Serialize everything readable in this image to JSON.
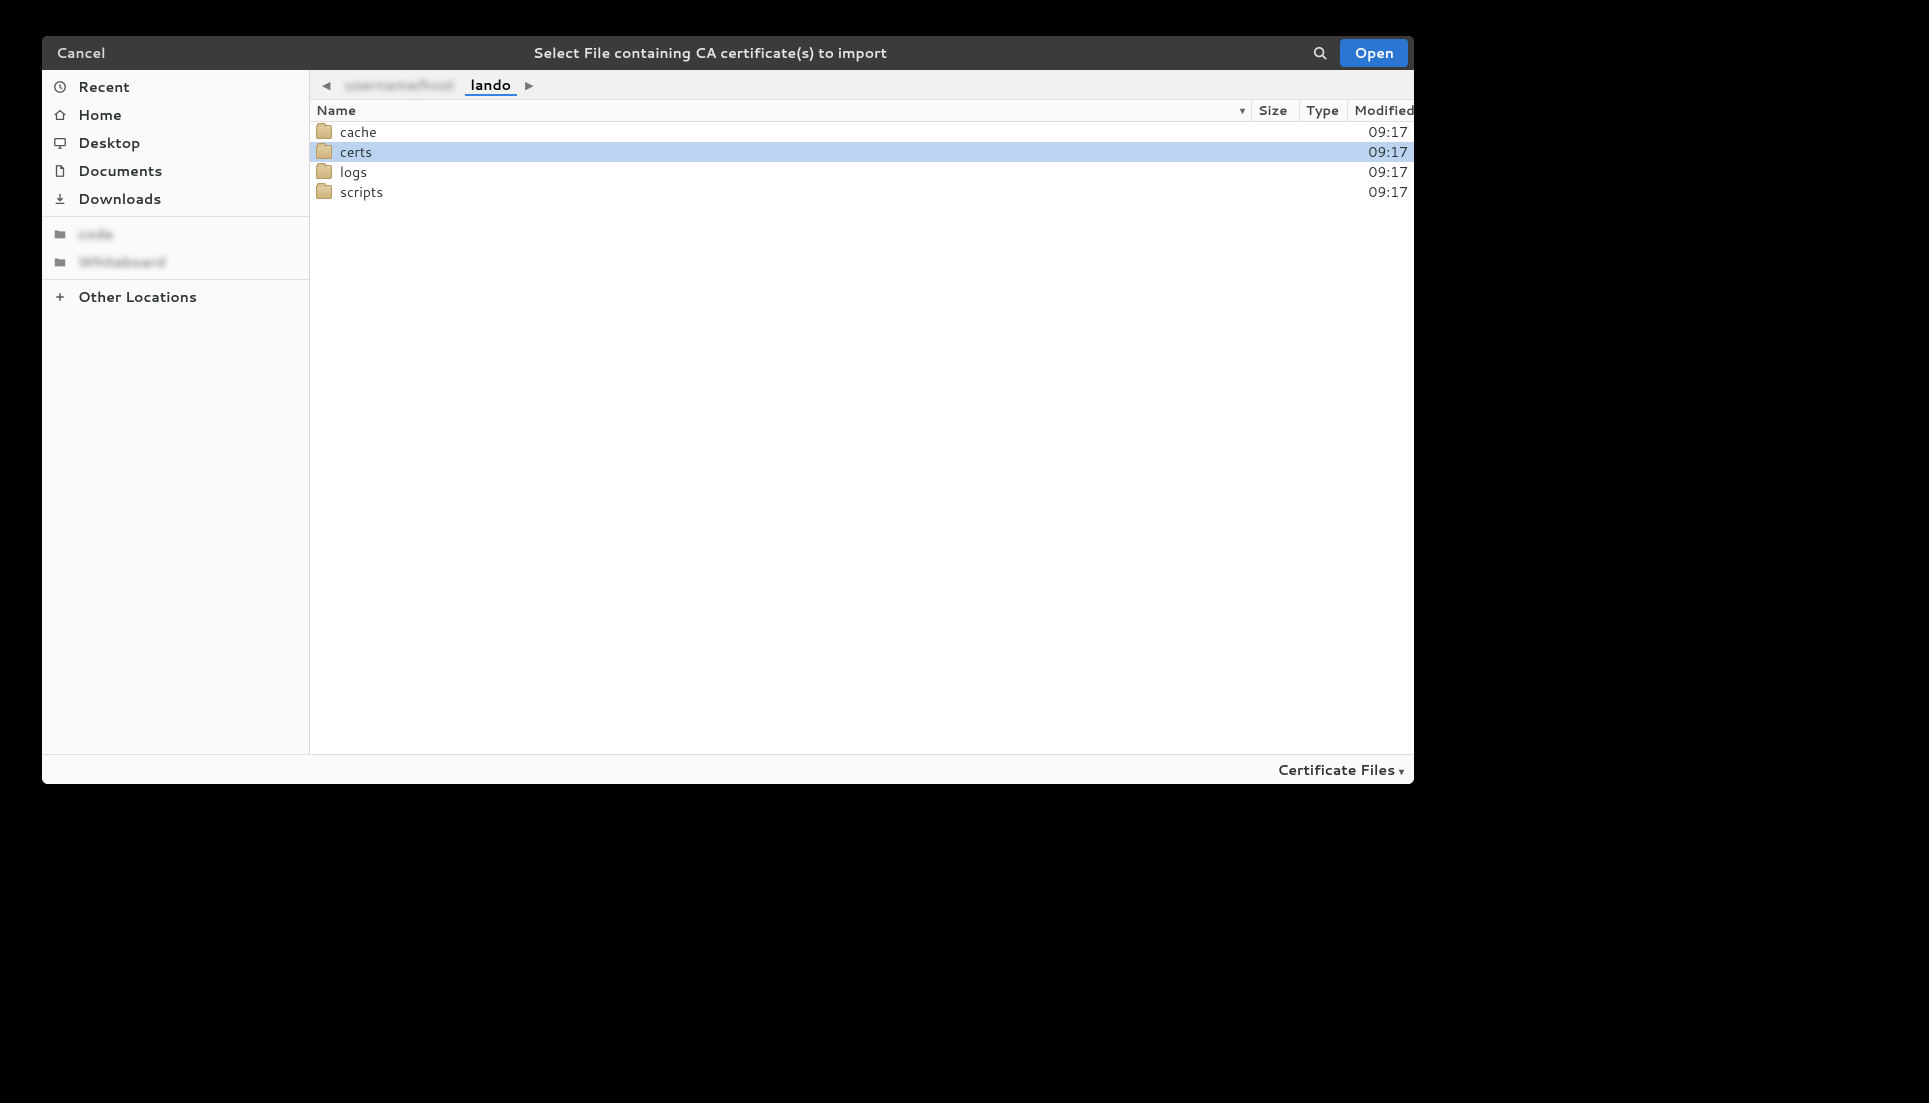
{
  "titlebar": {
    "cancel": "Cancel",
    "title": "Select File containing CA certificate(s) to import",
    "open": "Open"
  },
  "sidebar": {
    "places": [
      {
        "icon": "clock",
        "label": "Recent"
      },
      {
        "icon": "home",
        "label": "Home"
      },
      {
        "icon": "desktop",
        "label": "Desktop"
      },
      {
        "icon": "doc",
        "label": "Documents"
      },
      {
        "icon": "download",
        "label": "Downloads"
      }
    ],
    "bookmarks": [
      {
        "icon": "folder",
        "label": "code",
        "blurred": true
      },
      {
        "icon": "folder",
        "label": "Whiteboard",
        "blurred": true
      }
    ],
    "other": {
      "icon": "plus",
      "label": "Other Locations"
    }
  },
  "pathbar": {
    "segments": [
      {
        "label": "username/host",
        "blurred": true,
        "active": false
      },
      {
        "label": "lando",
        "blurred": false,
        "active": true
      }
    ]
  },
  "columns": {
    "name": "Name",
    "size": "Size",
    "type": "Type",
    "modified": "Modified"
  },
  "files": [
    {
      "name": "cache",
      "modified": "09:17",
      "selected": false
    },
    {
      "name": "certs",
      "modified": "09:17",
      "selected": true
    },
    {
      "name": "logs",
      "modified": "09:17",
      "selected": false
    },
    {
      "name": "scripts",
      "modified": "09:17",
      "selected": false
    }
  ],
  "footer": {
    "filter": "Certificate Files"
  }
}
